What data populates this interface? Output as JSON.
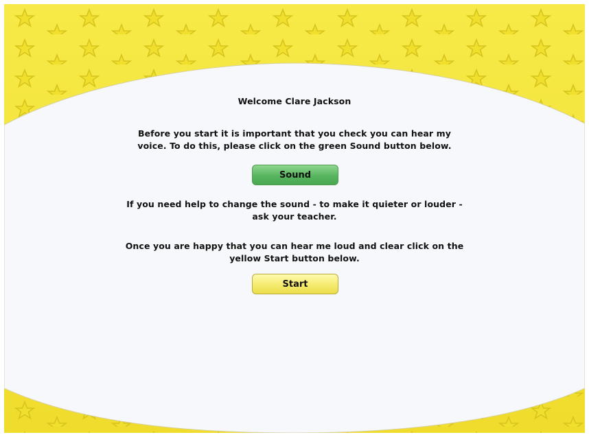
{
  "welcome_text": "Welcome Clare Jackson",
  "paragraphs": {
    "sound_check_line1": "Before you start it is important that you check you can hear my",
    "sound_check_line2": "voice. To do this, please click on the green Sound button below.",
    "help_line1": "If you need help to change the sound - to make it quieter or louder -",
    "help_line2": "ask your teacher.",
    "start_line1": "Once you are happy that you can hear me loud and clear click on the",
    "start_line2": "yellow Start button below."
  },
  "buttons": {
    "sound_label": "Sound",
    "start_label": "Start"
  },
  "colors": {
    "background_yellow": "#f5e63a",
    "panel": "#f7f8fb",
    "sound_button": "#58b55f",
    "start_button": "#f4ea6a"
  },
  "decoration": {
    "pattern_icon": "star-icon"
  }
}
